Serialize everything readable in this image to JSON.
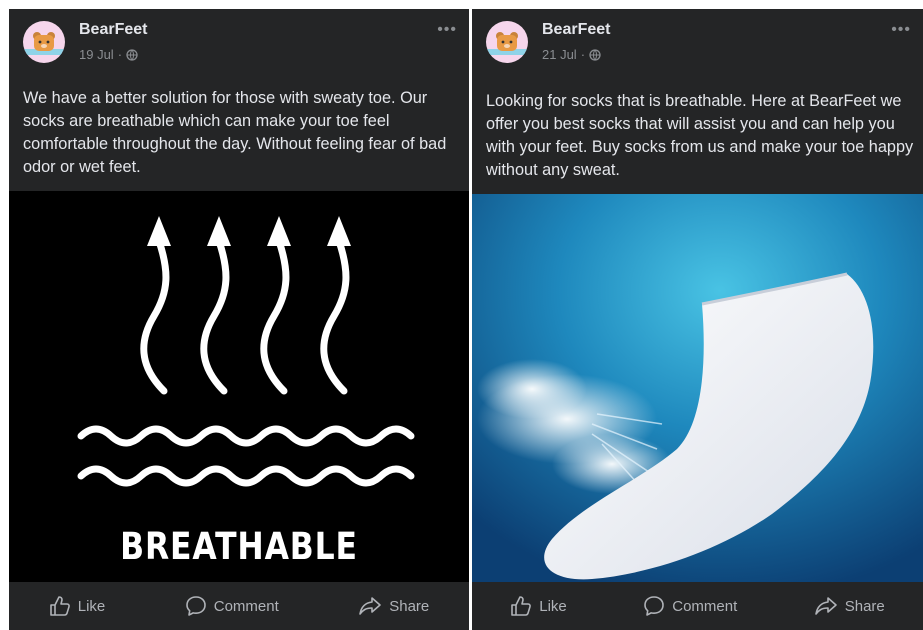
{
  "posts": [
    {
      "page_name": "BearFeet",
      "date": "19 Jul",
      "separator": "·",
      "caption": "We have a better solution for those with sweaty toe. Our socks are breathable which can make your toe feel comfortable throughout the day. Without feeling fear of bad odor or wet feet.",
      "image_text": "BREATHABLE",
      "actions": {
        "like": "Like",
        "comment": "Comment",
        "share": "Share"
      }
    },
    {
      "page_name": "BearFeet",
      "date": "21 Jul",
      "separator": "·",
      "caption": "Looking for socks that is breathable. Here at BearFeet we offer you best socks that will assist you and can help you with your feet. Buy socks from us and make your toe happy without any sweat.",
      "actions": {
        "like": "Like",
        "comment": "Comment",
        "share": "Share"
      }
    }
  ],
  "icons": {
    "more": "more-dots-icon",
    "privacy": "globe-icon",
    "like": "thumbs-up-icon",
    "comment": "comment-bubble-icon",
    "share": "share-arrow-icon"
  },
  "colors": {
    "card_background": "#242526",
    "primary_text": "#e4e6eb",
    "secondary_text": "#8a8d91",
    "avatar_background": "#f6d6ec"
  }
}
